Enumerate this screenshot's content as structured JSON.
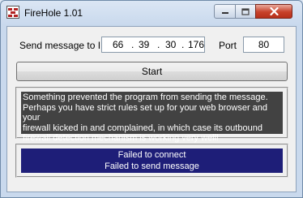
{
  "window": {
    "title": "FireHole 1.01",
    "controls": {
      "minimize_icon": "minimize-icon",
      "maximize_icon": "maximize-icon",
      "close_icon": "close-icon"
    }
  },
  "form": {
    "send_label": "Send message to IP",
    "ip": [
      "66",
      ".",
      "39",
      ".",
      "30",
      ".",
      "176"
    ],
    "port_label": "Port",
    "port_value": "80",
    "start_label": "Start"
  },
  "message": {
    "lines": [
      "Something prevented the program from sending the message.",
      "Perhaps you have strict rules set up for your web browser and your",
      "firewall kicked in and complained, in which case its outbound",
      "firewall detection mechanism is working very well!"
    ]
  },
  "status": {
    "lines": [
      "Failed to connect",
      "Failed to send message"
    ]
  },
  "colors": {
    "message_bg": "#424242",
    "status_bg": "#1e1e78",
    "close_button": "#c7412a"
  }
}
